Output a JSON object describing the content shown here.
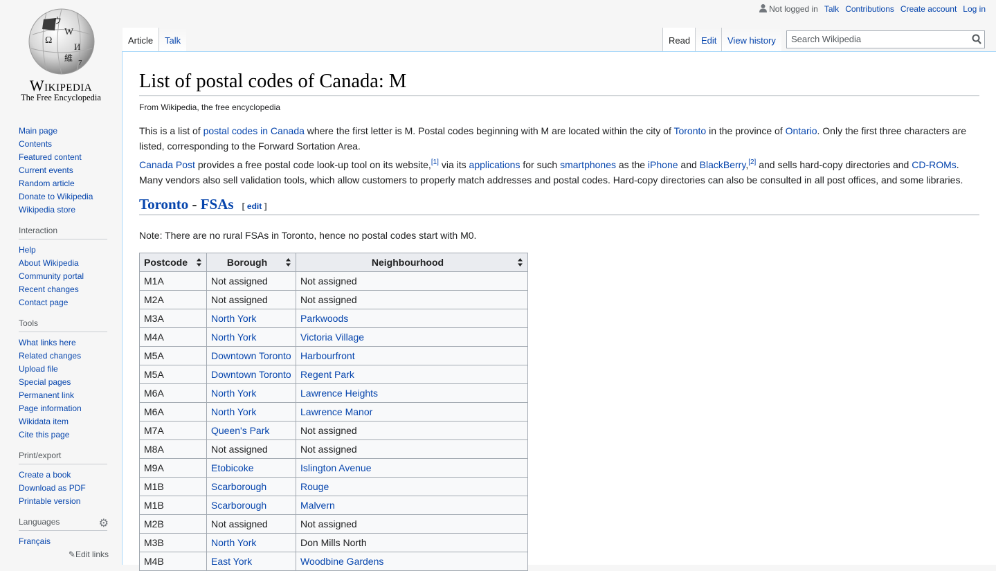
{
  "logo": {
    "wordmark": "Wikipedia",
    "tagline": "The Free Encyclopedia"
  },
  "personal": {
    "not_logged_in": "Not logged in",
    "talk": "Talk",
    "contributions": "Contributions",
    "create_account": "Create account",
    "log_in": "Log in"
  },
  "tabs": {
    "article": "Article",
    "talk": "Talk",
    "read": "Read",
    "edit": "Edit",
    "view_history": "View history"
  },
  "search": {
    "placeholder": "Search Wikipedia"
  },
  "sidebar": {
    "main": [
      "Main page",
      "Contents",
      "Featured content",
      "Current events",
      "Random article",
      "Donate to Wikipedia",
      "Wikipedia store"
    ],
    "interaction_title": "Interaction",
    "interaction": [
      "Help",
      "About Wikipedia",
      "Community portal",
      "Recent changes",
      "Contact page"
    ],
    "tools_title": "Tools",
    "tools": [
      "What links here",
      "Related changes",
      "Upload file",
      "Special pages",
      "Permanent link",
      "Page information",
      "Wikidata item",
      "Cite this page"
    ],
    "print_title": "Print/export",
    "print": [
      "Create a book",
      "Download as PDF",
      "Printable version"
    ],
    "languages_title": "Languages",
    "languages": [
      "Français"
    ],
    "edit_links": "Edit links"
  },
  "article": {
    "title": "List of postal codes of Canada: M",
    "sitesub": "From Wikipedia, the free encyclopedia",
    "p1": {
      "a": "This is a list of ",
      "l1": "postal codes in Canada",
      "b": " where the first letter is M. Postal codes beginning with M are located within the city of ",
      "l2": "Toronto",
      "c": " in the province of ",
      "l3": "Ontario",
      "d": ". Only the first three characters are listed, corresponding to the Forward Sortation Area."
    },
    "p2": {
      "l1": "Canada Post",
      "a": " provides a free postal code look-up tool on its website,",
      "ref1": "[1]",
      "b": " via its ",
      "l2": "applications",
      "c": " for such ",
      "l3": "smartphones",
      "d": " as the ",
      "l4": "iPhone",
      "e": " and ",
      "l5": "BlackBerry",
      "f": ",",
      "ref2": "[2]",
      "g": " and sells hard-copy directories and ",
      "l6": "CD-ROMs",
      "h": ". Many vendors also sell validation tools, which allow customers to properly match addresses and postal codes. Hard-copy directories can also be consulted in all post offices, and some libraries."
    },
    "section": {
      "l1": "Toronto",
      "dash": " - ",
      "l2": "FSAs",
      "edit_open": "[ ",
      "edit": "edit",
      "edit_close": " ]"
    },
    "note": "Note: There are no rural FSAs in Toronto, hence no postal codes start with M0.",
    "table": {
      "headers": [
        "Postcode",
        "Borough",
        "Neighbourhood"
      ],
      "rows": [
        [
          "M1A",
          "Not assigned",
          "Not assigned"
        ],
        [
          "M2A",
          "Not assigned",
          "Not assigned"
        ],
        [
          "M3A",
          "North York",
          "Parkwoods"
        ],
        [
          "M4A",
          "North York",
          "Victoria Village"
        ],
        [
          "M5A",
          "Downtown Toronto",
          "Harbourfront"
        ],
        [
          "M5A",
          "Downtown Toronto",
          "Regent Park"
        ],
        [
          "M6A",
          "North York",
          "Lawrence Heights"
        ],
        [
          "M6A",
          "North York",
          "Lawrence Manor"
        ],
        [
          "M7A",
          "Queen's Park",
          "Not assigned"
        ],
        [
          "M8A",
          "Not assigned",
          "Not assigned"
        ],
        [
          "M9A",
          "Etobicoke",
          "Islington Avenue"
        ],
        [
          "M1B",
          "Scarborough",
          "Rouge"
        ],
        [
          "M1B",
          "Scarborough",
          "Malvern"
        ],
        [
          "M2B",
          "Not assigned",
          "Not assigned"
        ],
        [
          "M3B",
          "North York",
          "Don Mills North"
        ],
        [
          "M4B",
          "East York",
          "Woodbine Gardens"
        ]
      ]
    }
  }
}
